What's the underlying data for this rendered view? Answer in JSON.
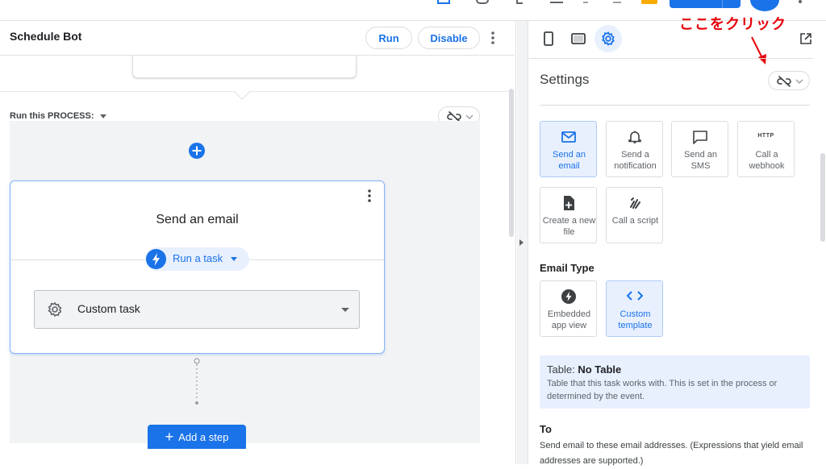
{
  "header": {
    "bot_title": "Schedule Bot",
    "run_label": "Run",
    "disable_label": "Disable"
  },
  "process": {
    "run_label": "Run this PROCESS:"
  },
  "step_card": {
    "title": "Send an email",
    "run_type_label": "Run a task",
    "task_value": "Custom task"
  },
  "add_step_label": "Add a step",
  "settings": {
    "annotation": "ここをクリック",
    "title": "Settings",
    "actions": [
      {
        "label": "Send an email",
        "icon": "mail-icon",
        "selected": true
      },
      {
        "label": "Send a notification",
        "icon": "bell-icon",
        "selected": false
      },
      {
        "label": "Send an SMS",
        "icon": "sms-icon",
        "selected": false
      },
      {
        "label": "Call a webhook",
        "icon": "HTTP",
        "selected": false
      },
      {
        "label": "Create a new file",
        "icon": "new-file-icon",
        "selected": false
      },
      {
        "label": "Call a script",
        "icon": "script-icon",
        "selected": false
      }
    ],
    "email_type_label": "Email Type",
    "email_types": [
      {
        "label": "Embedded app view",
        "icon": "bolt-icon",
        "selected": false
      },
      {
        "label": "Custom template",
        "icon": "code-icon",
        "selected": true
      }
    ],
    "table_prefix": "Table:",
    "table_value": "No Table",
    "table_desc": "Table that this task works with. This is set in the process or determined by the event.",
    "to_label": "To",
    "to_desc": "Send email to these email addresses. (Expressions that yield email addresses are supported.)"
  },
  "colors": {
    "accent": "#1a73e8",
    "accent_light": "#e8f0fe",
    "annotation_red": "#e8000b"
  }
}
